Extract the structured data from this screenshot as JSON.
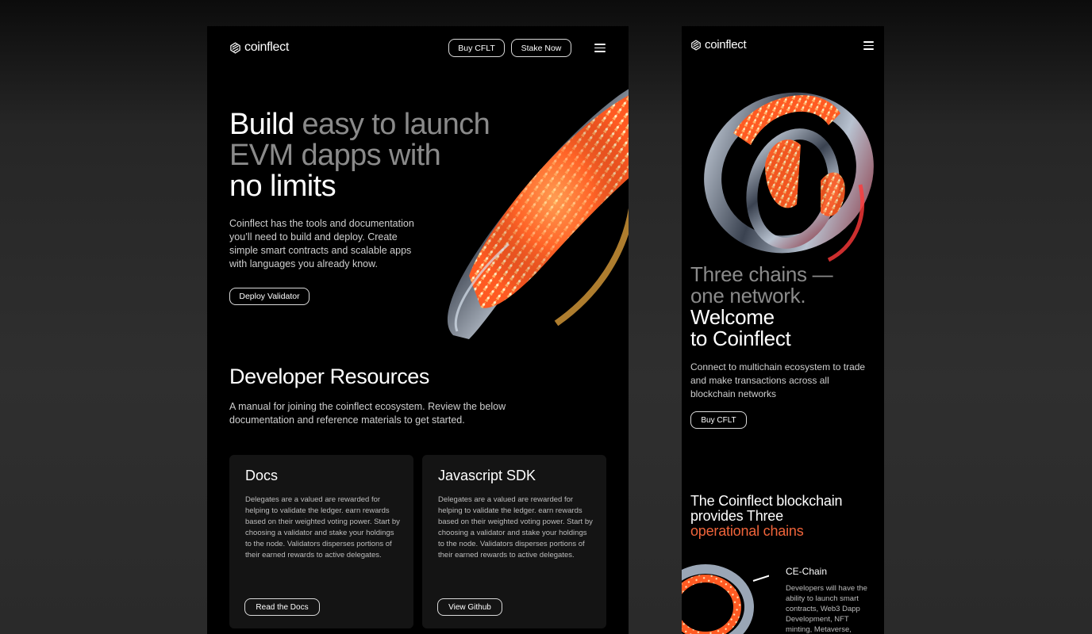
{
  "brand": {
    "name": "coinflect"
  },
  "desktop": {
    "nav": {
      "buy_label": "Buy CFLT",
      "stake_label": "Stake Now"
    },
    "hero": {
      "title_word1": "Build",
      "title_muted1": " easy to launch",
      "title_muted2": "EVM dapps with",
      "title_line3": "no limits",
      "description": "Coinflect has the tools and documentation you’ll need to build and deploy. Create simple smart contracts and scalable apps with languages you already know.",
      "cta_label": "Deploy Validator"
    },
    "resources": {
      "title": "Developer Resources",
      "description": "A manual for joining the coinflect ecosystem. Review the below documentation and reference materials to get started.",
      "cards": [
        {
          "title": "Docs",
          "text": "Delegates are a valued are rewarded for helping to validate the ledger. earn rewards based on their weighted voting power. Start by choosing a validator and stake your holdings to the node. Validators disperses portions of their earned rewards to active delegates.",
          "button_label": "Read the Docs"
        },
        {
          "title": "Javascript SDK",
          "text": "Delegates are a valued are rewarded for helping to validate the ledger. earn rewards based on their weighted voting power. Start by choosing a validator and stake your holdings to the node. Validators disperses portions of their earned rewards to active delegates.",
          "button_label": "View Github"
        }
      ]
    }
  },
  "mobile": {
    "hero": {
      "muted_line1": "Three chains —",
      "muted_line2": "one network.",
      "line3": "Welcome",
      "line4": "to Coinflect",
      "description": "Connect to multichain ecosystem to trade and make transactions across all blockchain networks",
      "cta_label": "Buy CFLT"
    },
    "chains": {
      "title_line1": "The Coinflect blockchain",
      "title_line2": "provides Three",
      "title_accent": "operational chains",
      "chain_name": "CE-Chain",
      "chain_text": "Developers will have the ability to launch smart contracts, Web3 Dapp Development, NFT minting, Metaverse,"
    }
  },
  "colors": {
    "accent": "#f0643a",
    "muted": "#8a8a8a",
    "background": "#000000",
    "card": "#141414"
  }
}
